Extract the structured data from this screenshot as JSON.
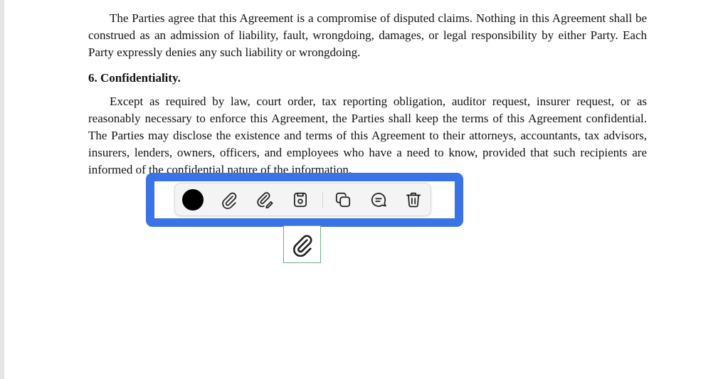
{
  "document": {
    "paragraph_1": "The Parties agree that this Agreement is a compromise of disputed claims. Nothing in this Agreement shall be construed as an admission of liability, fault, wrongdoing, damages, or legal responsibility by either Party. Each Party expressly denies any such liability or wrongdoing.",
    "section_6_heading": "6. Confidentiality.",
    "paragraph_2": "Except as required by law, court order, tax reporting obligation, auditor request, insurer request, or as reasonably necessary to enforce this Agreement, the Parties shall keep the terms of this Agreement confidential. The Parties may disclose the existence and terms of this Agreement to their attorneys, accountants, tax advisors, insurers, lenders, owners, officers, and employees who have a need to know, provided that such recipients are informed of the confidential nature of the information."
  },
  "annotation_toolbar": {
    "color": "#000000",
    "highlight_color": "#3a72e8",
    "buttons": [
      {
        "name": "color-picker",
        "icon": "filled-circle"
      },
      {
        "name": "attachment",
        "icon": "paperclip-icon"
      },
      {
        "name": "attachment-edit",
        "icon": "paperclip-edit-icon"
      },
      {
        "name": "save",
        "icon": "save-icon"
      },
      {
        "name": "copy",
        "icon": "copy-icon"
      },
      {
        "name": "comment",
        "icon": "comment-icon"
      },
      {
        "name": "delete",
        "icon": "trash-icon"
      }
    ]
  },
  "attachment_annotation": {
    "icon": "paperclip-icon",
    "border_color": "#6fae88"
  }
}
